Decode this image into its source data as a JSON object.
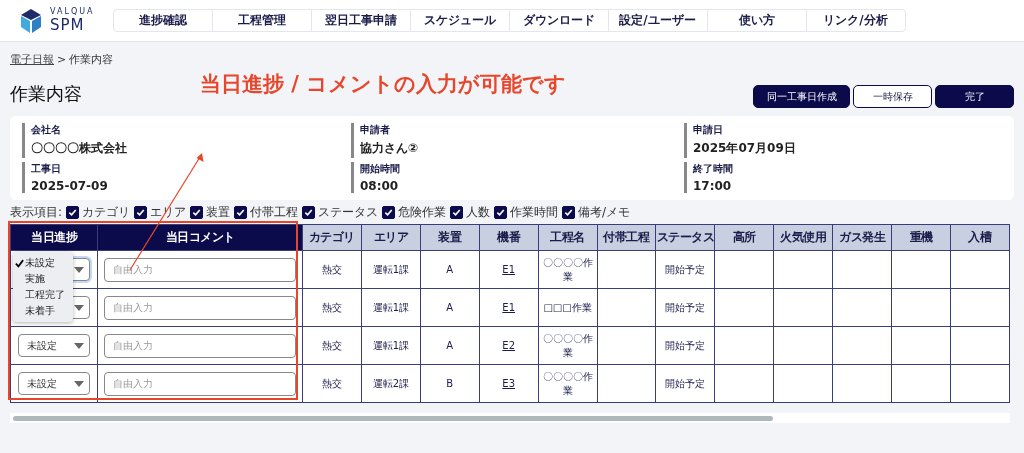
{
  "logo": {
    "top": "VALQUA",
    "main": "SPM"
  },
  "nav": [
    "進捗確認",
    "工程管理",
    "翌日工事申請",
    "スケジュール",
    "ダウンロード",
    "設定/ユーザー",
    "使い方",
    "リンク/分析"
  ],
  "breadcrumb": {
    "parent": "電子日報",
    "separator": ">",
    "current": "作業内容"
  },
  "annotation": "当日進捗 / コメントの入力が可能です",
  "page_title": "作業内容",
  "buttons": [
    {
      "label": "同一工事日作成",
      "kind": "primary"
    },
    {
      "label": "一時保存",
      "kind": "outline"
    },
    {
      "label": "完了",
      "kind": "primary"
    }
  ],
  "info_fields": [
    {
      "label": "会社名",
      "value": "〇〇〇〇株式会社"
    },
    {
      "label": "申請者",
      "value": "協力さん②"
    },
    {
      "label": "申請日",
      "value": "2025年07月09日"
    },
    {
      "label": "工事日",
      "value": "2025-07-09"
    },
    {
      "label": "開始時間",
      "value": "08:00"
    },
    {
      "label": "終了時間",
      "value": "17:00"
    }
  ],
  "display_items": {
    "label": "表示項目:",
    "options": [
      {
        "label": "カテゴリ",
        "checked": true
      },
      {
        "label": "エリア",
        "checked": true
      },
      {
        "label": "装置",
        "checked": true
      },
      {
        "label": "付帯工程",
        "checked": true
      },
      {
        "label": "ステータス",
        "checked": true
      },
      {
        "label": "危険作業",
        "checked": true
      },
      {
        "label": "人数",
        "checked": true
      },
      {
        "label": "作業時間",
        "checked": true
      },
      {
        "label": "備考/メモ",
        "checked": true
      }
    ]
  },
  "table": {
    "columns": [
      {
        "label": "当日進捗",
        "kind": "input"
      },
      {
        "label": "当日コメント",
        "kind": "input"
      },
      {
        "label": "カテゴリ",
        "kind": "data"
      },
      {
        "label": "エリア",
        "kind": "data"
      },
      {
        "label": "装置",
        "kind": "data"
      },
      {
        "label": "機番",
        "kind": "data"
      },
      {
        "label": "工程名",
        "kind": "data"
      },
      {
        "label": "付帯工程",
        "kind": "data"
      },
      {
        "label": "ステータス",
        "kind": "data"
      },
      {
        "label": "高所",
        "kind": "data"
      },
      {
        "label": "火気使用",
        "kind": "data"
      },
      {
        "label": "ガス発生",
        "kind": "data"
      },
      {
        "label": "重機",
        "kind": "data"
      },
      {
        "label": "入槽",
        "kind": "data"
      }
    ],
    "rows": [
      {
        "expanded": true,
        "options": [
          {
            "label": "未設定",
            "selected": true
          },
          {
            "label": "実施",
            "selected": false
          },
          {
            "label": "工程完了",
            "selected": false
          },
          {
            "label": "未着手",
            "selected": false
          }
        ],
        "comment_placeholder": "自由入力",
        "category": "熱交",
        "area": "運転1課",
        "device": "A",
        "unit": "E1",
        "process": "〇〇〇〇作業",
        "status": "開始予定"
      },
      {
        "expanded": false,
        "comment_placeholder": "自由入力",
        "category": "熱交",
        "area": "運転1課",
        "device": "A",
        "unit": "E1",
        "process": "□□□作業",
        "status": "開始予定"
      },
      {
        "progress": "未設定",
        "expanded": false,
        "comment_placeholder": "自由入力",
        "category": "熱交",
        "area": "運転1課",
        "device": "A",
        "unit": "E2",
        "process": "〇〇〇〇作業",
        "status": "開始予定"
      },
      {
        "progress": "未設定",
        "expanded": false,
        "comment_placeholder": "自由入力",
        "category": "熱交",
        "area": "運転2課",
        "device": "B",
        "unit": "E3",
        "process": "〇〇〇〇作業",
        "status": "開始予定"
      }
    ]
  }
}
